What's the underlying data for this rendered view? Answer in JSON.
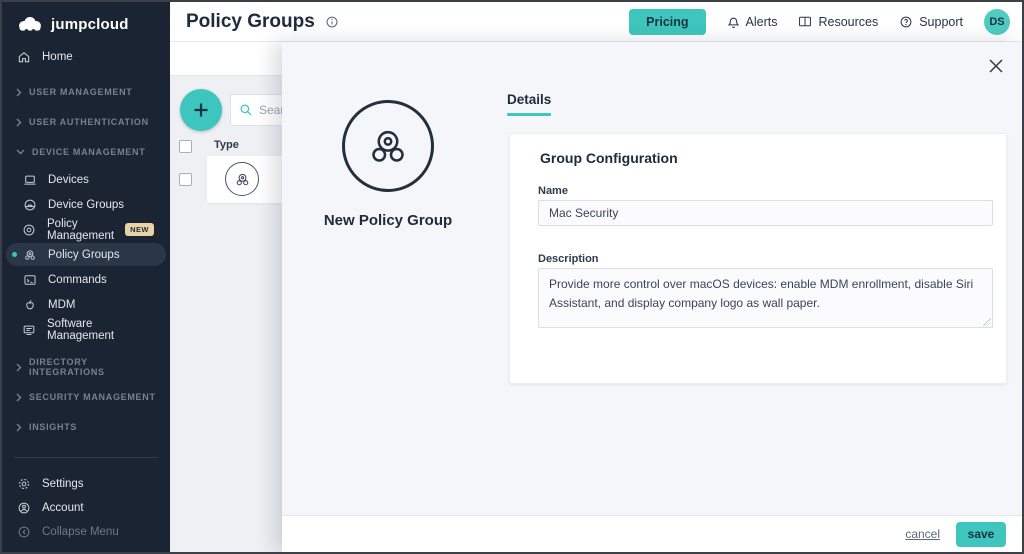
{
  "brand": {
    "name": "jumpcloud"
  },
  "sidebar": {
    "home_label": "Home",
    "sections": [
      {
        "label": "USER MANAGEMENT"
      },
      {
        "label": "USER AUTHENTICATION"
      },
      {
        "label": "DEVICE MANAGEMENT"
      },
      {
        "label": "DIRECTORY INTEGRATIONS"
      },
      {
        "label": "SECURITY MANAGEMENT"
      },
      {
        "label": "INSIGHTS"
      }
    ],
    "device_items": [
      {
        "label": "Devices"
      },
      {
        "label": "Device Groups"
      },
      {
        "label": "Policy Management",
        "badge": "NEW"
      },
      {
        "label": "Policy Groups"
      },
      {
        "label": "Commands"
      },
      {
        "label": "MDM"
      },
      {
        "label": "Software Management"
      }
    ],
    "footer_items": [
      {
        "label": "Settings"
      },
      {
        "label": "Account"
      },
      {
        "label": "Collapse Menu"
      }
    ]
  },
  "header": {
    "title": "Policy Groups",
    "pricing_label": "Pricing",
    "alerts_label": "Alerts",
    "resources_label": "Resources",
    "support_label": "Support",
    "avatar_initials": "DS"
  },
  "list": {
    "search_placeholder": "Search",
    "type_header": "Type"
  },
  "panel": {
    "title": "New Policy Group",
    "tab_label": "Details",
    "card_title": "Group Configuration",
    "name_label": "Name",
    "name_value": "Mac Security",
    "description_label": "Description",
    "description_value": "Provide more control over macOS devices: enable MDM enrollment, disable Siri Assistant, and display company logo as wall paper.",
    "cancel_label": "cancel",
    "save_label": "save"
  },
  "colors": {
    "accent": "#3EC5BD",
    "sidebar_bg": "#1A2433",
    "navy_text": "#1E2B3C",
    "badge_bg": "#E7D3A4"
  }
}
